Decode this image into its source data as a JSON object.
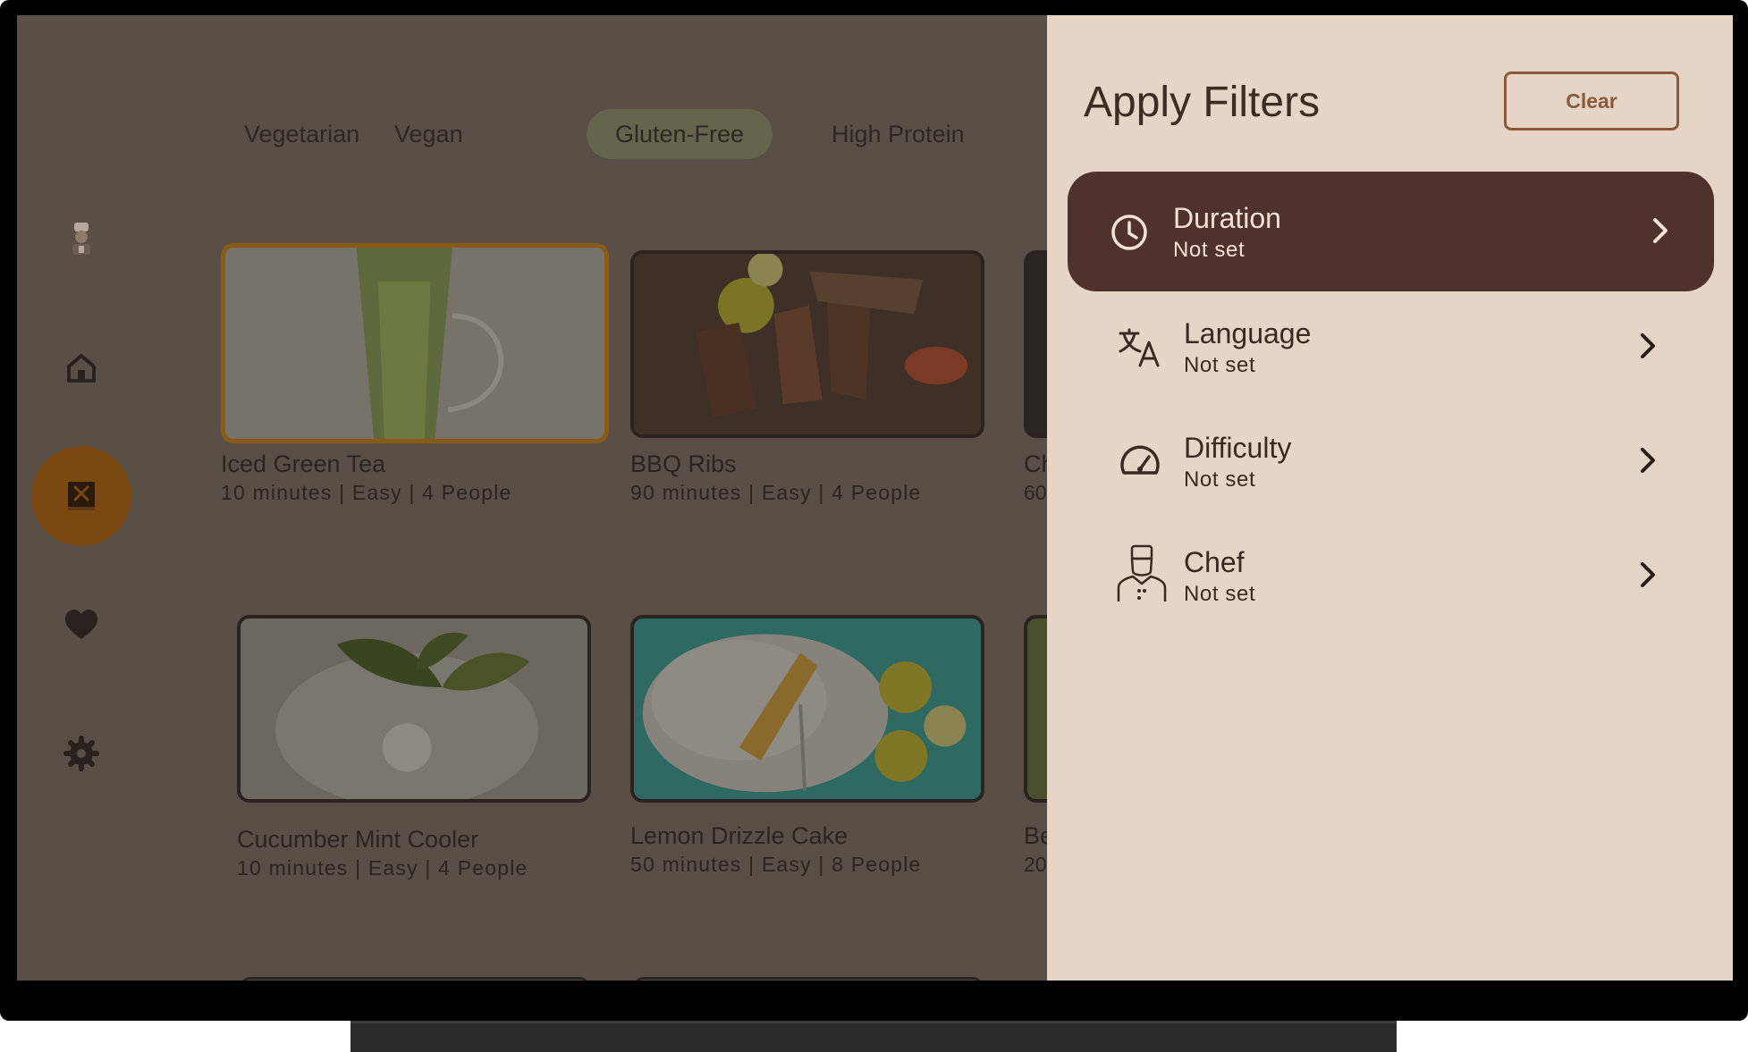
{
  "tabs": [
    "Vegetarian",
    "Vegan",
    "Gluten-Free",
    "High Protein"
  ],
  "active_tab": "Gluten-Free",
  "nav": {
    "items": [
      "chef-avatar",
      "home",
      "recipes",
      "favorites",
      "settings"
    ],
    "active": "recipes"
  },
  "recipes": [
    {
      "title": "Iced Green Tea",
      "meta": "10 minutes | Easy | 4 People"
    },
    {
      "title": "BBQ Ribs",
      "meta": "90 minutes | Easy | 4 People"
    },
    {
      "title": "Cucumber Mint Cooler",
      "meta": "10 minutes | Easy | 4 People"
    },
    {
      "title": "Lemon Drizzle Cake",
      "meta": "50 minutes | Easy | 8 People"
    }
  ],
  "peek_cards": [
    {
      "title": "Ch",
      "meta": "60"
    },
    {
      "title": "Be",
      "meta": "20"
    }
  ],
  "filters_panel": {
    "title": "Apply Filters",
    "clear_label": "Clear",
    "items": [
      {
        "label": "Duration",
        "value": "Not set",
        "icon": "clock-icon"
      },
      {
        "label": "Language",
        "value": "Not set",
        "icon": "translate-icon"
      },
      {
        "label": "Difficulty",
        "value": "Not set",
        "icon": "speedometer-icon"
      },
      {
        "label": "Chef",
        "value": "Not set",
        "icon": "chef-icon"
      }
    ]
  },
  "colors": {
    "scrim": "#5a4f47",
    "panel_bg": "#e6d5c6",
    "selected_filter": "#4f322c",
    "accent": "#8a5a3a",
    "nav_active": "#7a4810"
  }
}
